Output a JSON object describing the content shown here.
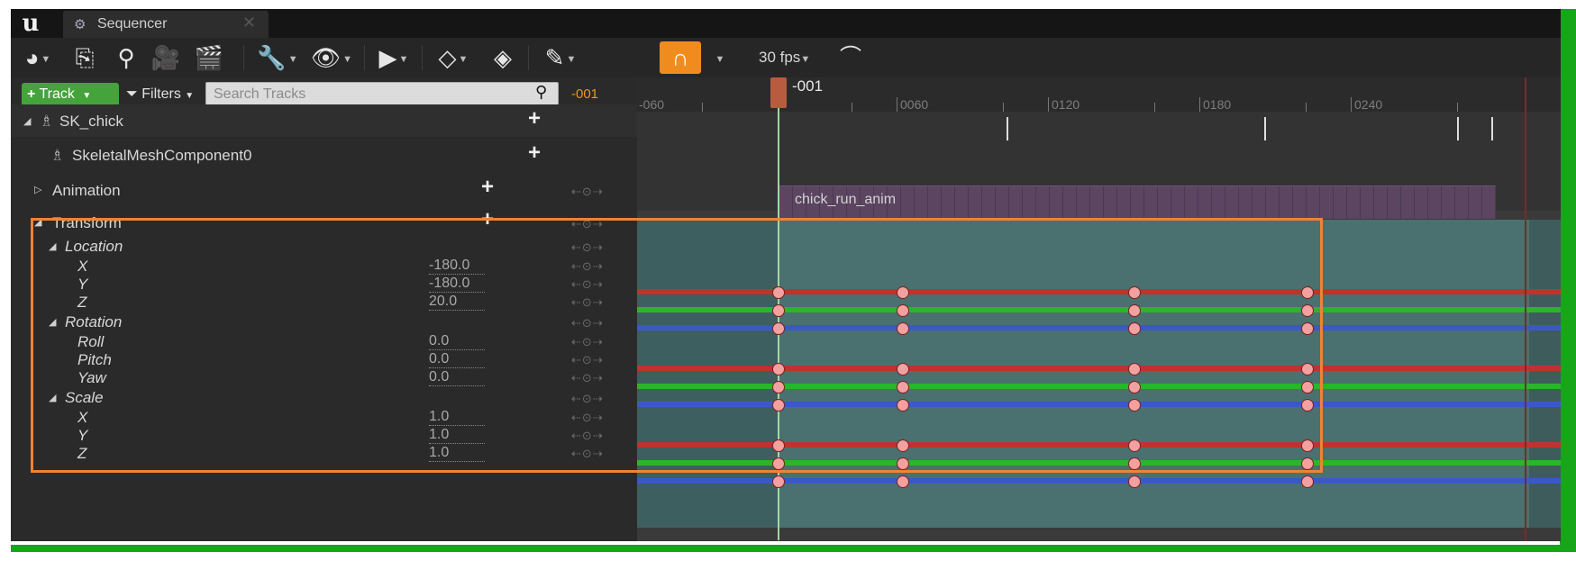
{
  "window": {
    "tab_title": "Sequencer",
    "tab_icon": "sequencer-icon",
    "close_glyph": "✕"
  },
  "toolbar": {
    "fps_label": "30 fps",
    "buttons": [
      "world-icon",
      "save-icon",
      "search-icon",
      "camera-icon",
      "clapperboard-icon",
      "wrench-icon",
      "eye-icon",
      "play-icon",
      "keyframe-icon",
      "key-icon",
      "pencil-icon",
      "magnet-icon",
      "curve-editor-icon"
    ]
  },
  "outliner": {
    "track_button": "Track",
    "filters_button": "Filters",
    "search_placeholder": "Search Tracks",
    "current_frame": "-001",
    "rows": {
      "actor": "SK_chick",
      "component": "SkeletalMeshComponent0",
      "animation": "Animation",
      "transform": "Transform",
      "location": "Location",
      "loc_x": "X",
      "loc_x_val": "-180.0",
      "loc_y": "Y",
      "loc_y_val": "-180.0",
      "loc_z": "Z",
      "loc_z_val": "20.0",
      "rotation": "Rotation",
      "roll": "Roll",
      "roll_val": "0.0",
      "pitch": "Pitch",
      "pitch_val": "0.0",
      "yaw": "Yaw",
      "yaw_val": "0.0",
      "scale": "Scale",
      "sc_x": "X",
      "sc_x_val": "1.0",
      "sc_y": "Y",
      "sc_y_val": "1.0",
      "sc_z": "Z",
      "sc_z_val": "1.0"
    },
    "key_nav": "⇠⊙⇢"
  },
  "timeline": {
    "ticks": [
      "-060",
      "0060",
      "0120",
      "0180",
      "0240"
    ],
    "playhead_label": "-001",
    "clip_label": "chick_run_anim"
  },
  "colors": {
    "accent_orange": "#f08236",
    "track_green": "#45a33c",
    "channel_red": "#c0322e",
    "channel_green": "#2bb52b",
    "channel_blue": "#3b58c9"
  }
}
